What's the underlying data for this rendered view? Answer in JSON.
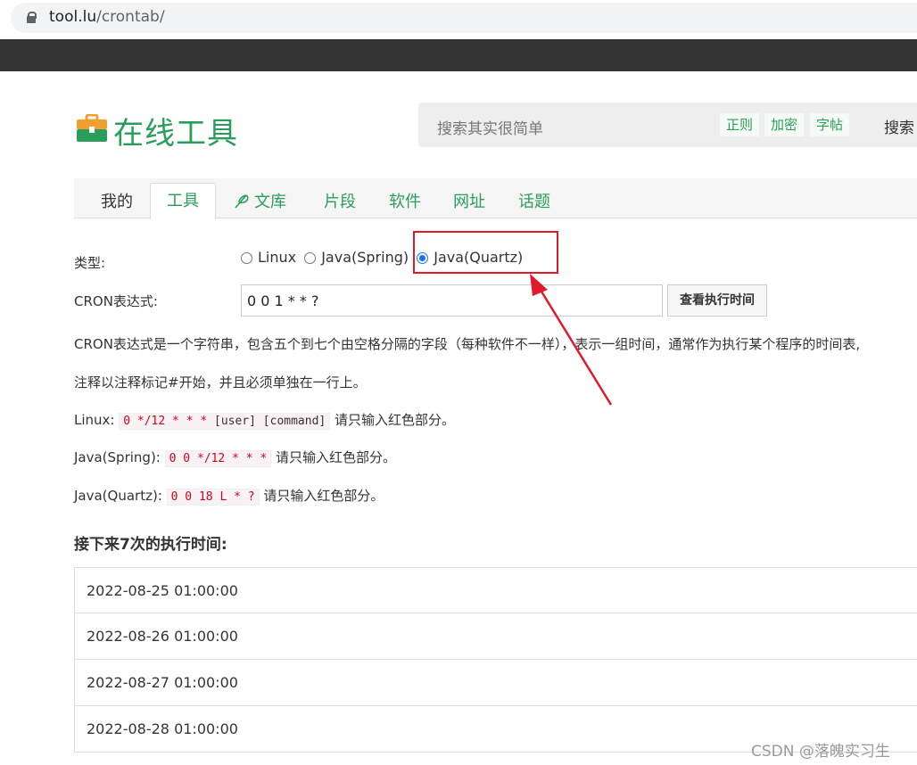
{
  "browser": {
    "url_host": "tool.lu",
    "url_path": "/crontab/"
  },
  "header": {
    "logo_text": "在线工具",
    "search_placeholder": "搜索其实很简单",
    "quick_tags": [
      "正则",
      "加密",
      "字帖"
    ],
    "search_button": "搜索"
  },
  "tabs": [
    {
      "label": "我的"
    },
    {
      "label": "工具"
    },
    {
      "label": "文库"
    },
    {
      "label": "片段"
    },
    {
      "label": "软件"
    },
    {
      "label": "网址"
    },
    {
      "label": "话题"
    }
  ],
  "form": {
    "type_label": "类型:",
    "options": [
      "Linux",
      "Java(Spring)",
      "Java(Quartz)"
    ],
    "selected_option": "Java(Quartz)",
    "cron_label": "CRON表达式:",
    "cron_value": "0 0 1 * * ?",
    "run_button": "查看执行时间"
  },
  "description": {
    "line1": "CRON表达式是一个字符串，包含五个到七个由空格分隔的字段（每种软件不一样），表示一组时间，通常作为执行某个程序的时间表,",
    "line2": "注释以注释标记#开始，并且必须单独在一行上。",
    "examples": [
      {
        "label": "Linux:",
        "red": "0 */12 * * *",
        "plain": "[user] [command]",
        "suffix": "请只输入红色部分。"
      },
      {
        "label": "Java(Spring):",
        "red": "0 0 */12 * * *",
        "plain": "",
        "suffix": "请只输入红色部分。"
      },
      {
        "label": "Java(Quartz):",
        "red": "0 0 18 L * ?",
        "plain": "",
        "suffix": "请只输入红色部分。"
      }
    ]
  },
  "results": {
    "heading": "接下来7次的执行时间:",
    "times": [
      "2022-08-25 01:00:00",
      "2022-08-26 01:00:00",
      "2022-08-27 01:00:00",
      "2022-08-28 01:00:00"
    ]
  },
  "watermark": "CSDN @落魄实习生",
  "colors": {
    "brand_green": "#2a9d5a",
    "annotation_red": "#e0192b",
    "radio_blue": "#1a73e8"
  }
}
